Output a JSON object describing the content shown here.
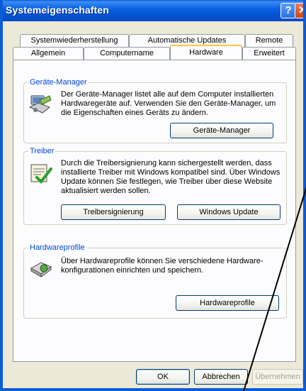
{
  "window": {
    "title": "Systemeigenschaften"
  },
  "titlebar": {
    "help_glyph": "?",
    "close_glyph": "✕"
  },
  "tabs": {
    "row1": [
      {
        "label": "Systemwiederherstellung"
      },
      {
        "label": "Automatische Updates"
      },
      {
        "label": "Remote"
      }
    ],
    "row2": [
      {
        "label": "Allgemein"
      },
      {
        "label": "Computername"
      },
      {
        "label": "Hardware",
        "active": true
      },
      {
        "label": "Erweitert"
      }
    ]
  },
  "device_manager": {
    "title": "Geräte-Manager",
    "description_lines": [
      "Der Geräte-Manager listet alle auf dem Computer installierten",
      "Hardwaregeräte auf. Verwenden Sie den Geräte-Manager, um",
      "die Eigenschaften eines Geräts zu ändern."
    ],
    "button": "Geräte-Manager",
    "icon": "device-manager-icon"
  },
  "drivers": {
    "title": "Treiber",
    "description_lines": [
      "Durch die Treibersignierung kann sichergestellt werden, dass",
      "installierte Treiber mit Windows kompatibel sind. Über Windows",
      "Update können Sie festlegen, wie Treiber über diese Website",
      "aktualisiert werden sollen."
    ],
    "signing_button": "Treibersignierung",
    "update_button": "Windows Update",
    "icon": "driver-signing-icon"
  },
  "hardware_profiles": {
    "title": "Hardwareprofile",
    "description_lines": [
      "Über Hardwareprofile können Sie verschiedene Hardware-",
      "konfigurationen einrichten und speichern."
    ],
    "button": "Hardwareprofile",
    "icon": "hardware-profiles-icon"
  },
  "footer": {
    "ok": "OK",
    "cancel": "Abbrechen",
    "apply": "Übernehmen"
  },
  "colors": {
    "titlebar": "#0A5BD6",
    "dialog_bg": "#ECE9D8",
    "panel_bg": "#FCFCFE",
    "group_label": "#0046D5",
    "active_tab_accent": "#FFC83C"
  }
}
